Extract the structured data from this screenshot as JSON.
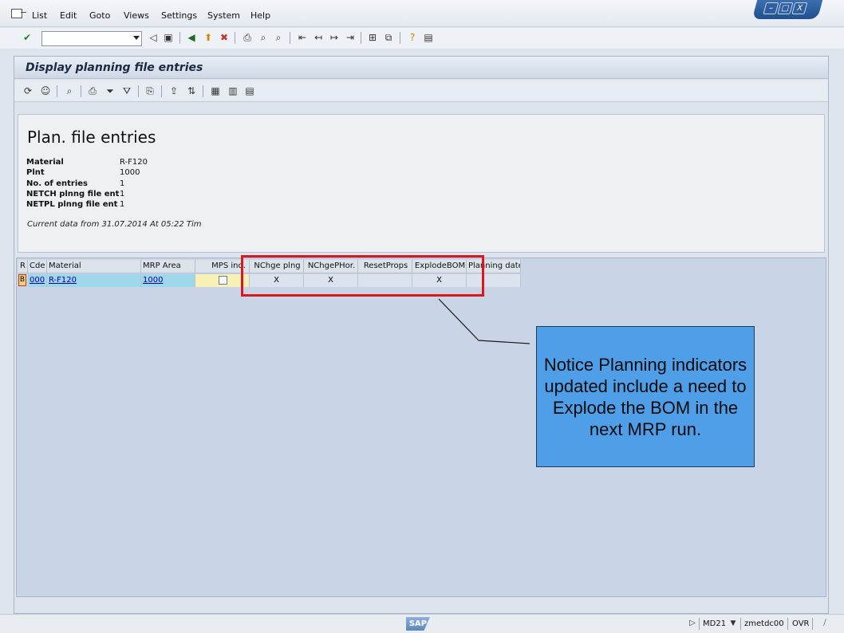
{
  "menubar": {
    "items": [
      {
        "label": "List",
        "u": "L"
      },
      {
        "label": "Edit",
        "u": "E"
      },
      {
        "label": "Goto",
        "u": "G"
      },
      {
        "label": "Views",
        "u": "V"
      },
      {
        "label": "Settings",
        "u": "S"
      },
      {
        "label": "System",
        "u": "S"
      },
      {
        "label": "Help",
        "u": "H"
      }
    ],
    "list": "List",
    "edit": "Edit",
    "goto": "Goto",
    "views": "Views",
    "settings": "Settings",
    "system": "System",
    "help": "Help"
  },
  "window_controls": {
    "minimize": "–",
    "maximize": "□",
    "close": "X"
  },
  "system_toolbar": {
    "command_value": "",
    "icons": [
      "enter-icon",
      "back-icon",
      "save-icon",
      "back-green-icon",
      "exit-icon",
      "cancel-icon",
      "print-icon",
      "find-icon",
      "find-next-icon",
      "first-page-icon",
      "previous-page-icon",
      "next-page-icon",
      "last-page-icon",
      "create-session-icon",
      "shortcut-icon",
      "help-icon",
      "layout-icon"
    ]
  },
  "screen": {
    "title": "Display planning file entries"
  },
  "app_toolbar": {
    "icons": [
      "refresh-icon",
      "user-icon",
      "details-icon",
      "print-icon",
      "set-filter-icon",
      "filter-icon",
      "choose-icon",
      "export-icon",
      "sort-icon",
      "layout-grid-icon",
      "change-layout-icon",
      "save-layout-icon"
    ]
  },
  "header": {
    "heading": "Plan. file entries",
    "fields": [
      {
        "label": "Material",
        "value": "R-F120"
      },
      {
        "label": "Plnt",
        "value": "1000"
      },
      {
        "label": "No. of entries",
        "value": "1"
      },
      {
        "label": "NETCH plnng file ent",
        "value": "1"
      },
      {
        "label": "NETPL plnng file ent",
        "value": "1"
      }
    ],
    "current_data": "Current data from 31.07.2014 At 05:22 Tim"
  },
  "grid": {
    "columns": [
      "R",
      "Cde",
      "Material",
      "MRP Area",
      "MPS ind.",
      "NChge plng",
      "NChgePHor.",
      "ResetProps",
      "ExplodeBOM",
      "Planning date"
    ],
    "row": {
      "r": "B",
      "cde": "000",
      "material": "R-F120",
      "mrp_area": "1000",
      "mps_ind": "",
      "nchge_plng": "X",
      "nchge_phor": "X",
      "reset_props": "",
      "explode_bom": "X",
      "planning_date": ""
    }
  },
  "callout": {
    "text": "Notice Planning indicators updated include a need to Explode the BOM in the next MRP run."
  },
  "statusbar": {
    "logo": "SAP",
    "transaction": "MD21",
    "server": "zmetdc00",
    "mode": "OVR"
  },
  "colors": {
    "highlight": "#d9181c",
    "callout": "#4f9ee8",
    "key_cell": "#9fd7ea",
    "mps_cell": "#f7f0b7"
  }
}
